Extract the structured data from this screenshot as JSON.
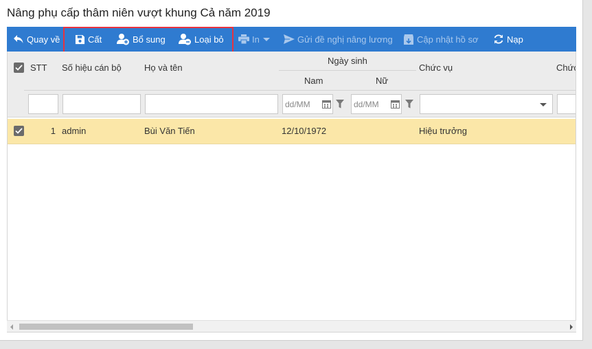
{
  "page": {
    "title": "Nâng phụ cấp thâm niên vượt khung Cả năm 2019"
  },
  "toolbar": {
    "back_label": "Quay về",
    "save_label": "Cất",
    "add_label": "Bổ sung",
    "remove_label": "Loại bỏ",
    "print_label": "In",
    "send_label": "Gửi đề nghị nâng lương",
    "update_label": "Cập nhật hồ sơ",
    "reload_label": "Nạp",
    "highlight_color": "#e8333f",
    "bar_color": "#2f7bd0"
  },
  "table": {
    "headers": {
      "stt": "STT",
      "employee_code": "Số hiệu cán bộ",
      "full_name": "Họ và tên",
      "birth_date": "Ngày sinh",
      "male": "Nam",
      "female": "Nữ",
      "position": "Chức vụ",
      "position_cut": "Chức"
    },
    "filters": {
      "date_placeholder": "dd/MM"
    },
    "rows": [
      {
        "stt": "1",
        "employee_code": "admin",
        "full_name": "Bùi Văn Tiến",
        "birth_male": "12/10/1972",
        "birth_female": "",
        "position": "Hiệu trưởng",
        "selected": true
      }
    ],
    "selected_row_color": "#fbe7a8"
  }
}
